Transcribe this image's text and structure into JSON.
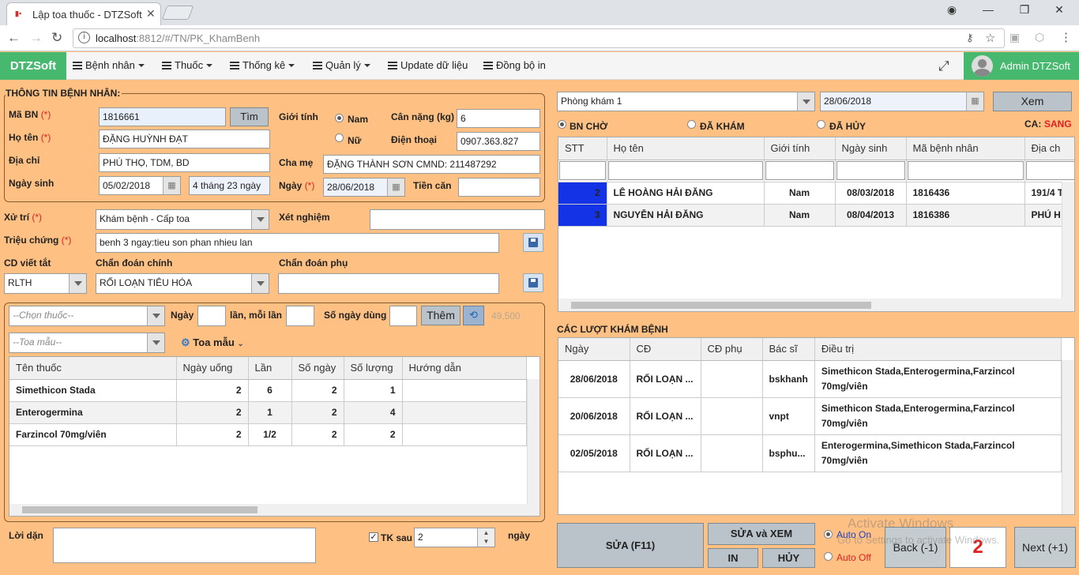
{
  "browser": {
    "tab_title": "Lập toa thuốc - DTZSoft",
    "url_host": "localhost",
    "url_rest": ":8812/#/TN/PK_KhamBenh"
  },
  "nav": {
    "brand": "DTZSoft",
    "items": [
      "Bệnh nhân",
      "Thuốc",
      "Thống kê",
      "Quản lý",
      "Update dữ liệu",
      "Đồng bộ in"
    ],
    "user": "Admin DTZSoft"
  },
  "patient": {
    "section_title": "THÔNG TIN BỆNH NHÂN:",
    "ma_bn_label": "Mã BN",
    "ma_bn": "1816661",
    "tim_button": "Tìm",
    "gioi_tinh_label": "Giới tính",
    "nam": "Nam",
    "nu": "Nữ",
    "can_nang_label": "Cân nặng (kg)",
    "can_nang": "6",
    "ho_ten_label": "Họ tên",
    "ho_ten": "ĐẶNG HUỲNH ĐẠT",
    "dien_thoai_label": "Điện thoại",
    "dien_thoai": "0907.363.827",
    "dia_chi_label": "Địa chỉ",
    "dia_chi": "PHÚ THỌ, TDM, BD",
    "cha_me_label": "Cha mẹ",
    "cha_me": "ĐẶNG THÀNH SƠN  CMND: 211487292",
    "ngay_sinh_label": "Ngày sinh",
    "ngay_sinh": "05/02/2018",
    "tuoi": "4 tháng 23 ngày",
    "ngay_label": "Ngày",
    "ngay": "28/06/2018",
    "tien_can_label": "Tiền căn",
    "tien_can": ""
  },
  "exam": {
    "xu_tri_label": "Xử trí",
    "xu_tri": "Khám bệnh - Cấp toa",
    "xet_nghiem_label": "Xét nghiệm",
    "xet_nghiem": "",
    "trieu_chung_label": "Triệu chứng",
    "trieu_chung": "benh 3 ngay:tieu son phan nhieu lan",
    "cd_viet_tat_label": "CD viết tắt",
    "cd_viet_tat": "RLTH",
    "chan_doan_chinh_label": "Chẩn đoán chính",
    "chan_doan_chinh": "RỐI LOẠN TIÊU HÓA",
    "chan_doan_phu_label": "Chẩn đoán phụ",
    "chan_doan_phu": ""
  },
  "prescription": {
    "chon_thuoc_placeholder": "--Chọn thuốc--",
    "ngay_label": "Ngày",
    "lan_moi_lan_label": "lần, mỗi lần",
    "so_ngay_dung_label": "Số ngày dùng",
    "them_button": "Thêm",
    "price": "49,500",
    "toa_mau_placeholder": "--Toa mẫu--",
    "toa_mau_button": "Toa mẫu",
    "columns": [
      "Tên thuốc",
      "Ngày uống",
      "Lần",
      "Số ngày",
      "Số lượng",
      "Hướng dẫn"
    ],
    "rows": [
      {
        "ten": "Simethicon Stada",
        "ngay_uong": "2",
        "lan": "6",
        "so_ngay": "2",
        "so_luong": "1",
        "huong_dan": ""
      },
      {
        "ten": "Enterogermina",
        "ngay_uong": "2",
        "lan": "1",
        "so_ngay": "2",
        "so_luong": "4",
        "huong_dan": ""
      },
      {
        "ten": "Farzincol 70mg/viên",
        "ngay_uong": "2",
        "lan": "1/2",
        "so_ngay": "2",
        "so_luong": "2",
        "huong_dan": ""
      }
    ]
  },
  "footer_left": {
    "loi_dan_label": "Lời dặn",
    "tk_sau_label": "TK sau",
    "tk_sau": "2",
    "ngay_label": "ngày"
  },
  "right": {
    "phong_kham": "Phòng khám 1",
    "date": "28/06/2018",
    "xem_button": "Xem",
    "tabs": [
      "BN CHỜ",
      "ĐÃ KHÁM",
      "ĐÃ HỦY"
    ],
    "ca_label": "CA:",
    "ca_value": "SANG",
    "queue_columns": [
      "STT",
      "Họ tên",
      "Giới tính",
      "Ngày sinh",
      "Mã bệnh nhân",
      "Địa ch"
    ],
    "queue_rows": [
      {
        "stt": "2",
        "ho_ten": "LÊ HOÀNG HẢI ĐĂNG",
        "gioi_tinh": "Nam",
        "ngay_sinh": "08/03/2018",
        "ma_bn": "1816436",
        "dia_chi": "191/4 T"
      },
      {
        "stt": "3",
        "ho_ten": "NGUYỄN HẢI ĐĂNG",
        "gioi_tinh": "Nam",
        "ngay_sinh": "08/04/2013",
        "ma_bn": "1816386",
        "dia_chi": "PHÚ H"
      }
    ],
    "history_title": "CÁC LƯỢT KHÁM BỆNH",
    "history_columns": [
      "Ngày",
      "CĐ",
      "CĐ phụ",
      "Bác sĩ",
      "Điều trị"
    ],
    "history_rows": [
      {
        "ngay": "28/06/2018",
        "cd": "RỐI LOẠN ...",
        "cd_phu": "",
        "bac_si": "bskhanh",
        "dieu_tri": "Simethicon Stada,Enterogermina,Farzincol 70mg/viên"
      },
      {
        "ngay": "20/06/2018",
        "cd": "RỐI LOẠN ...",
        "cd_phu": "",
        "bac_si": "vnpt",
        "dieu_tri": "Simethicon Stada,Enterogermina,Farzincol 70mg/viên"
      },
      {
        "ngay": "02/05/2018",
        "cd": "RỐI LOẠN ...",
        "cd_phu": "",
        "bac_si": "bsphu...",
        "dieu_tri": "Enterogermina,Simethicon Stada,Farzincol 70mg/viên"
      }
    ]
  },
  "actions": {
    "sua": "SỬA (F11)",
    "sua_xem": "SỬA và XEM",
    "in": "IN",
    "huy": "HỦY",
    "auto_on": "Auto On",
    "auto_off": "Auto Off",
    "back": "Back (-1)",
    "counter": "2",
    "next": "Next (+1)",
    "watermark_1": "Activate Windows",
    "watermark_2": "Go to Settings to activate Windows."
  },
  "colors": {
    "background": "#fec083",
    "brand_green": "#47b96e",
    "stt_blue": "#1433e6",
    "required_red": "#d22222",
    "shift_red": "#e02020"
  }
}
